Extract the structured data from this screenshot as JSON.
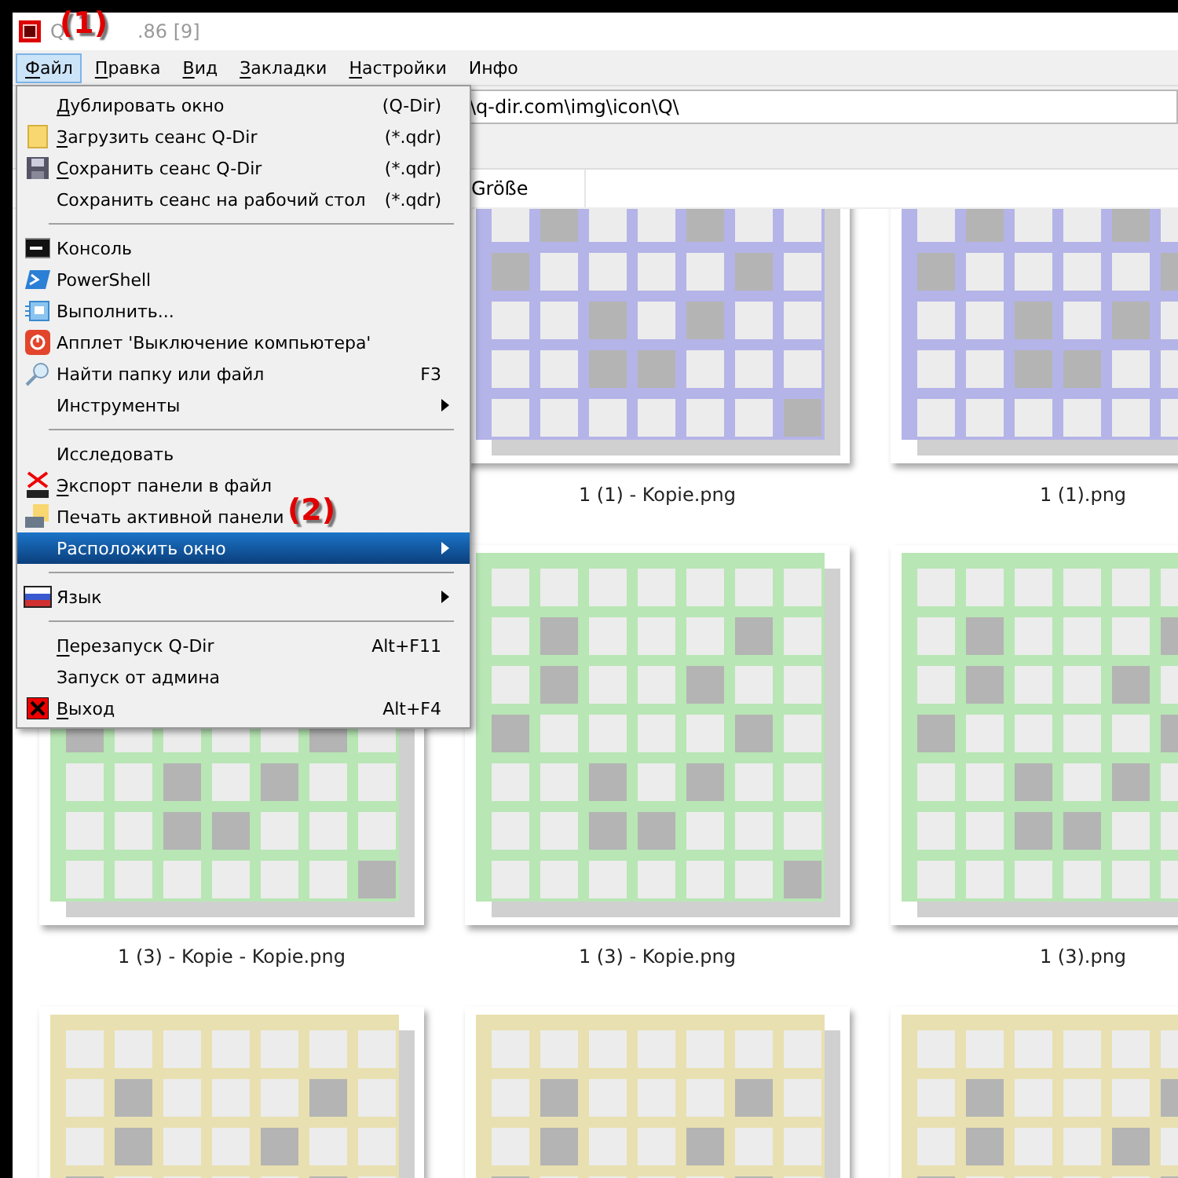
{
  "window": {
    "title_start": "Q",
    "title_end": ".86 [9]"
  },
  "annotations": [
    {
      "label": "(1)"
    },
    {
      "label": "(2)"
    }
  ],
  "menubar": [
    {
      "label": "Файл",
      "selected": true
    },
    {
      "label": "Правка",
      "selected": false
    },
    {
      "label": "Вид",
      "selected": false
    },
    {
      "label": "Закладки",
      "selected": false
    },
    {
      "label": "Настройки",
      "selected": false
    },
    {
      "label": "Инфо",
      "selected": false
    }
  ],
  "menu": [
    {
      "kind": "item",
      "label": "Дублировать окно",
      "underline_first": true,
      "shortcut": "(Q-Dir)",
      "submenu": false,
      "selected": false
    },
    {
      "kind": "item",
      "label": "Загрузить сеанс Q-Dir",
      "underline_first": true,
      "shortcut": "(*.qdr)",
      "submenu": false,
      "selected": false
    },
    {
      "kind": "item",
      "label": "Сохранить сеанс Q-Dir",
      "underline_first": true,
      "shortcut": "(*.qdr)",
      "submenu": false,
      "selected": false
    },
    {
      "kind": "item",
      "label": "Сохранить сеанс на рабочий стол",
      "underline_first": false,
      "shortcut": "(*.qdr)",
      "submenu": false,
      "selected": false
    },
    {
      "kind": "separator"
    },
    {
      "kind": "item",
      "label": "Консоль",
      "underline_first": false,
      "submenu": false,
      "selected": false
    },
    {
      "kind": "item",
      "label": "PowerShell",
      "underline_first": false,
      "submenu": false,
      "selected": false
    },
    {
      "kind": "item",
      "label": "Выполнить...",
      "underline_first": false,
      "submenu": false,
      "selected": false
    },
    {
      "kind": "item",
      "label": "Апплет 'Выключение компьютера'",
      "underline_first": false,
      "submenu": false,
      "selected": false
    },
    {
      "kind": "item",
      "label": "Найти папку или файл",
      "underline_first": false,
      "shortcut": "F3",
      "submenu": false,
      "selected": false
    },
    {
      "kind": "item",
      "label": "Инструменты",
      "underline_first": false,
      "submenu": true,
      "selected": false
    },
    {
      "kind": "separator"
    },
    {
      "kind": "item",
      "label": "Исследовать",
      "underline_first": false,
      "submenu": false,
      "selected": false
    },
    {
      "kind": "item",
      "label": "Экспорт панели в файл",
      "underline_first": true,
      "submenu": false,
      "selected": false
    },
    {
      "kind": "item",
      "label": "Печать активной панели",
      "underline_first": false,
      "submenu": false,
      "selected": false
    },
    {
      "kind": "item",
      "label": "Расположить окно",
      "underline_first": false,
      "submenu": true,
      "selected": true
    },
    {
      "kind": "separator"
    },
    {
      "kind": "item",
      "label": "Язык",
      "underline_first": false,
      "submenu": true,
      "selected": false
    },
    {
      "kind": "separator"
    },
    {
      "kind": "item",
      "label": "Перезапуск Q-Dir",
      "underline_first": true,
      "shortcut": "Alt+F11",
      "submenu": false,
      "selected": false
    },
    {
      "kind": "item",
      "label": "Запуск от админа",
      "underline_first": false,
      "submenu": false,
      "selected": false
    },
    {
      "kind": "item",
      "label": "Выход",
      "underline_first": true,
      "shortcut": "Alt+F4",
      "submenu": false,
      "selected": false
    }
  ],
  "address": {
    "value": "\\q-dir.com\\img\\icon\\Q\\"
  },
  "columns": [
    {
      "label": "Größe"
    }
  ],
  "thumbnail_rows": [
    [
      {
        "color": "#b4b4e8",
        "caption": "1 (1) - Kopie.png"
      },
      {
        "color": "#b4b4e8",
        "caption": "1 (1).png"
      }
    ],
    [
      {
        "color": "#b8e6b4",
        "caption": "1 (3) - Kopie - Kopie.png"
      },
      {
        "color": "#b8e6b4",
        "caption": "1 (3) - Kopie.png"
      },
      {
        "color": "#b8e6b4",
        "caption": "1 (3).png"
      }
    ],
    [
      {
        "color": "#e8e0b0"
      },
      {
        "color": "#e8e0b0"
      },
      {
        "color": "#e8e0b0"
      }
    ]
  ]
}
